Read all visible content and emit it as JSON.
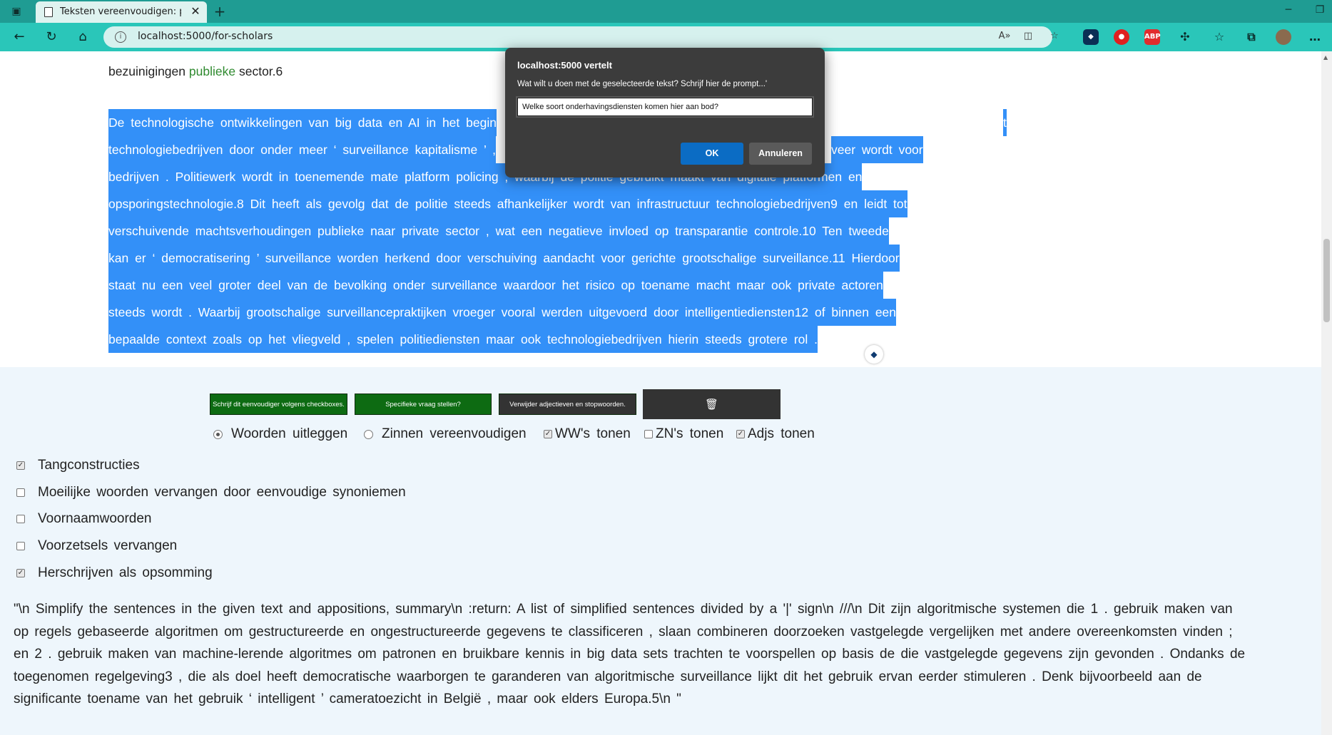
{
  "browser": {
    "tab_title": "Teksten vereenvoudigen: prototy",
    "url": "localhost:5000/for-scholars"
  },
  "article": {
    "prev_line": {
      "before": "bezuinigingen",
      "highlight": "publieke",
      "after": "sector.6"
    },
    "selected_lines": [
      "De technologische ontwikkelingen van big data en AI in het begin",
      "technologiebedrijven door onder meer ‘ surveillance kapitalisme ’ ,",
      "bedrijven . Politiewerk wordt in toenemende mate platform policing , waarbij de politie gebruikt maakt van digitale platformen en",
      "opsporingstechnologie.8 Dit heeft als gevolg dat de politie steeds afhankelijker wordt van infrastructuur technologiebedrijven9 en leidt tot",
      "verschuivende machtsverhoudingen publieke naar private sector , wat een negatieve invloed op transparantie controle.10 Ten tweede",
      "kan er ‘ democratisering ’ surveillance worden herkend door verschuiving aandacht voor gerichte grootschalige surveillance.11 Hierdoor",
      "staat nu een veel groter deel van de bevolking onder surveillance waardoor het risico op toename macht maar ook private actoren",
      "steeds wordt . Waarbij grootschalige surveillancepraktijken vroeger vooral werden uitgevoerd door intelligentiediensten12 of binnen een",
      "bepaalde context zoals op het vliegveld , spelen politiediensten maar ook technologiebedrijven hierin steeds grotere rol ."
    ],
    "right_fragments": {
      "line1": "t",
      "line2": "veer wordt voor"
    }
  },
  "buttons": {
    "simplify": "Schrijf dit eenvoudiger volgens checkboxes.",
    "question": "Specifieke vraag stellen?",
    "remove": "Verwijder adjectieven en stopwoorden.",
    "trash_icon": "🗑"
  },
  "options": {
    "radio_explain": "Woorden uitleggen",
    "radio_simplify": "Zinnen vereenvoudigen",
    "check_ww": "WW's tonen",
    "check_zn": "ZN's tonen",
    "check_adj": "Adjs tonen"
  },
  "checkboxes": [
    {
      "label": "Tangconstructies",
      "checked": true
    },
    {
      "label": "Moeilijke woorden vervangen door eenvoudige synoniemen",
      "checked": false
    },
    {
      "label": "Voornaamwoorden",
      "checked": false
    },
    {
      "label": "Voorzetsels vervangen",
      "checked": false
    },
    {
      "label": "Herschrijven als opsomming",
      "checked": true
    }
  ],
  "output": {
    "lines": [
      "\"\\n Simplify the sentences in the given text and appositions, summary\\n :return: A list of simplified sentences divided by a '|' sign\\n ///\\n Dit zijn algoritmische systemen die 1 . gebruik maken van",
      "op regels gebaseerde algoritmen om gestructureerde en ongestructureerde gegevens te classificeren , slaan combineren doorzoeken vastgelegde vergelijken met andere overeenkomsten vinden ;",
      "en 2 . gebruik maken van machine-lerende algoritmes om patronen en bruikbare kennis in big data sets trachten te voorspellen op basis de die vastgelegde gegevens zijn gevonden . Ondanks de",
      "toegenomen regelgeving3 , die als doel heeft democratische waarborgen te garanderen van algoritmische surveillance lijkt dit het gebruik ervan eerder stimuleren . Denk bijvoorbeeld aan de",
      "significante toename van het gebruik ‘ intelligent ’ cameratoezicht in België , maar ook elders Europa.5\\n \""
    ]
  },
  "dialog": {
    "title": "localhost:5000 vertelt",
    "message": "Wat wilt u doen met de geselecteerde tekst? Schrijf hier de prompt...'",
    "input_value": "Welke soort onderhavingsdiensten komen hier aan bod?",
    "ok": "OK",
    "cancel": "Annuleren"
  },
  "colors": {
    "tabbar": "#1f9c93",
    "addressbar": "#2ac6b9",
    "selection": "#3390f8",
    "button_green": "#0d6b12",
    "button_dark": "#333333",
    "dialog_ok": "#0b6cc4"
  }
}
